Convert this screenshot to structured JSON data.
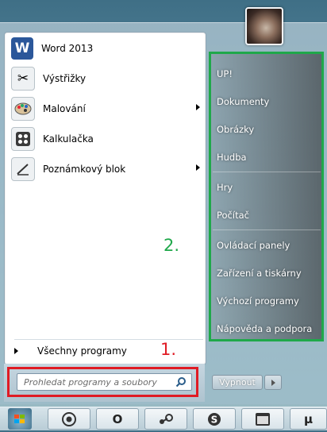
{
  "start_menu": {
    "pinned_apps": [
      {
        "label": "Word 2013",
        "icon": "word-icon",
        "has_submenu": false
      },
      {
        "label": "Výstřižky",
        "icon": "scissors-icon",
        "has_submenu": false
      },
      {
        "label": "Malování",
        "icon": "paint-palette-icon",
        "has_submenu": true
      },
      {
        "label": "Kalkulačka",
        "icon": "calculator-icon",
        "has_submenu": false
      },
      {
        "label": "Poznámkový blok",
        "icon": "notepad-icon",
        "has_submenu": true
      }
    ],
    "all_programs_label": "Všechny programy",
    "search": {
      "placeholder": "Prohledat programy a soubory"
    },
    "right_links": [
      "UP!",
      "Dokumenty",
      "Obrázky",
      "Hudba",
      "Hry",
      "Počítač",
      "Ovládací panely",
      "Zařízení a tiskárny",
      "Výchozí programy",
      "Nápověda a podpora"
    ],
    "shutdown_label": "Vypnout"
  },
  "annotations": {
    "label_1": "1.",
    "label_2": "2."
  },
  "colors": {
    "annotation_red": "#e01b24",
    "annotation_green": "#1fa84a"
  },
  "taskbar": {
    "items": [
      "start-orb-icon",
      "chrome-icon",
      "opera-icon",
      "steam-icon",
      "skype-icon",
      "window-icon",
      "utorrent-icon"
    ]
  }
}
